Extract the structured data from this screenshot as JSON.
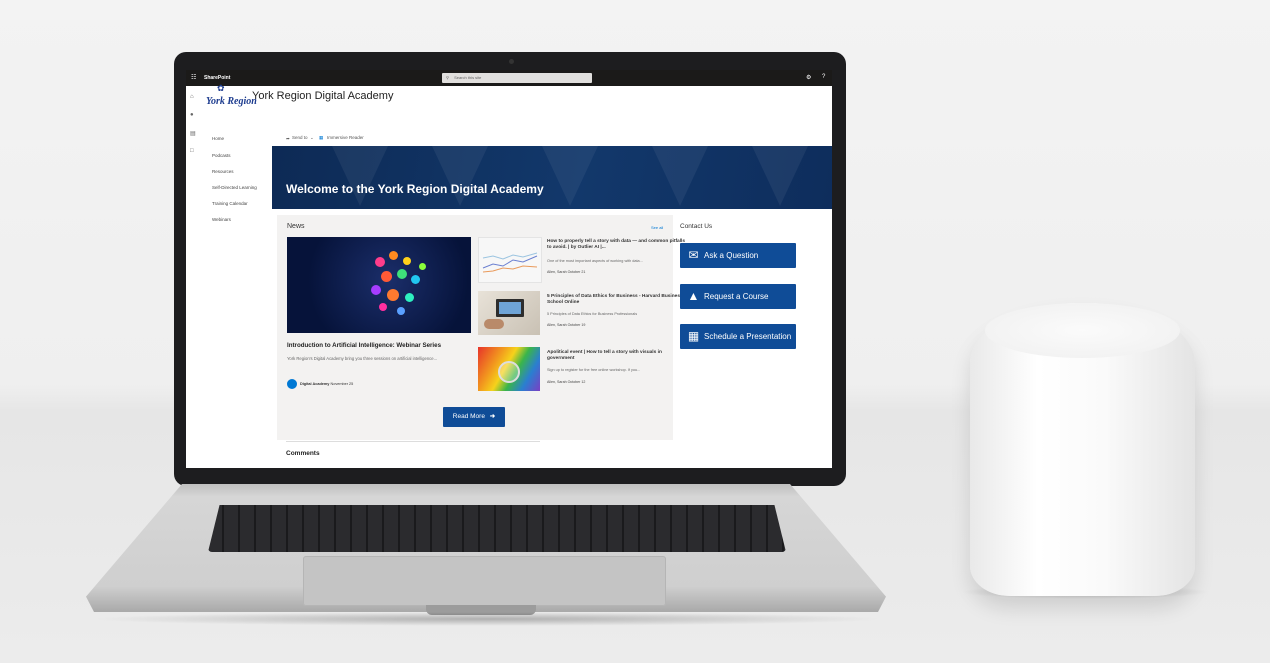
{
  "topbar": {
    "brand": "SharePoint",
    "search_placeholder": "Search this site",
    "icons": [
      "waffle-icon",
      "settings-gear-icon",
      "help-icon"
    ]
  },
  "header": {
    "logo_text": "York Region",
    "site_title": "York Region Digital Academy"
  },
  "leftnav": {
    "items": [
      {
        "label": "Home"
      },
      {
        "label": "Podcasts"
      },
      {
        "label": "Resources"
      },
      {
        "label": "Self-Directed Learning"
      },
      {
        "label": "Training Calendar"
      },
      {
        "label": "Webinars"
      }
    ]
  },
  "commandbar": {
    "send_to": "Send to",
    "immersive_reader": "Immersive Reader"
  },
  "hero": {
    "title": "Welcome to the York Region Digital Academy"
  },
  "news": {
    "heading": "News",
    "see_all": "See all",
    "featured": {
      "title": "Introduction to Artificial Intelligence: Webinar Series",
      "description": "York Region's Digital Academy bring you three sessions on artificial intelligence...",
      "author": "Digital Academy",
      "date": "November 25"
    },
    "articles": [
      {
        "title": "How to properly tell a story with data — and common pitfalls to avoid. | by Outlier AI |...",
        "description": "One of the most important aspects of working with data...",
        "meta": "Allen, Sarah October 21"
      },
      {
        "title": "5 Principles of Data Ethics for Business - Harvard Business School Online",
        "description": "5 Principles of Data Ethics for Business Professionals",
        "meta": "Allen, Sarah October 19"
      },
      {
        "title": "Apolitical event | How to tell a story with visuals in government",
        "description": "Sign up to register for the free online workshop. If you...",
        "meta": "Allen, Sarah October 12"
      }
    ],
    "read_more": "Read More"
  },
  "comments": {
    "heading": "Comments"
  },
  "contact": {
    "heading": "Contact Us",
    "buttons": [
      {
        "label": "Ask a Question",
        "icon": "envelope-icon"
      },
      {
        "label": "Request a Course",
        "icon": "graduation-cap-icon"
      },
      {
        "label": "Schedule a Presentation",
        "icon": "calendar-icon"
      }
    ]
  },
  "colors": {
    "accent": "#0f4c97",
    "hero_bg": "#12386b",
    "topbar_bg": "#1b1a19"
  }
}
